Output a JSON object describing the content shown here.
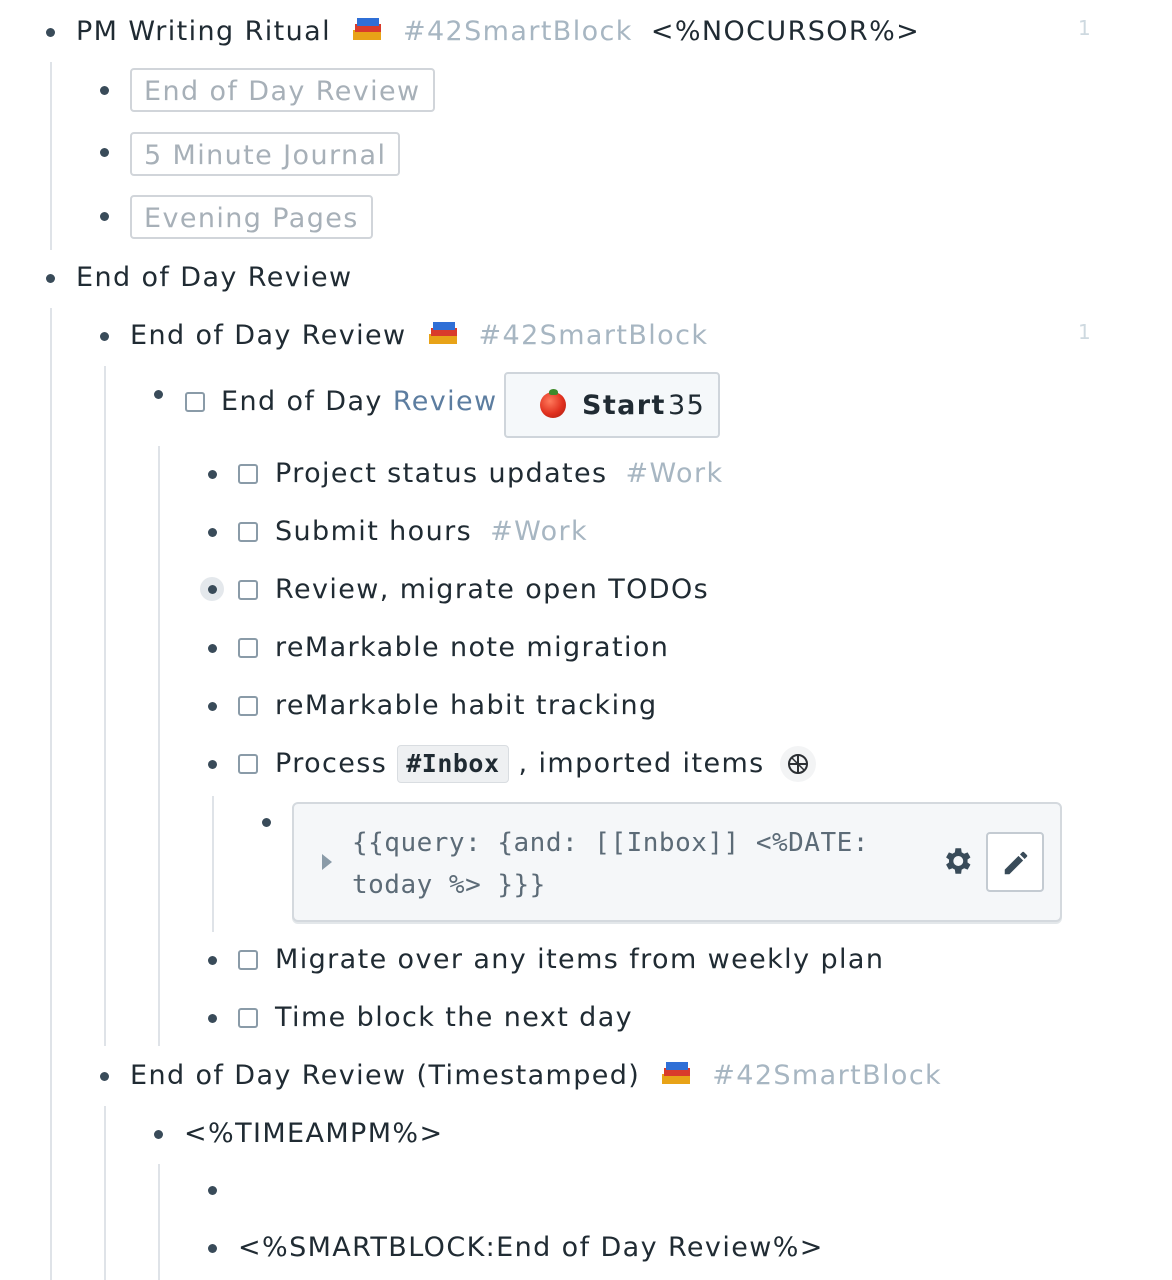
{
  "tags": {
    "smartblock": "#42SmartBlock",
    "work": "#Work",
    "inbox": "#Inbox"
  },
  "colors": {
    "tag": "#a7b6c2",
    "link": "#5c7da0",
    "text": "#202b33",
    "bullet": "#394b59"
  },
  "blocks": {
    "pm_ritual": {
      "title": "PM Writing Ritual",
      "suffix": "<%NOCURSOR%>",
      "ref_count": "1",
      "children": [
        "End of Day Review",
        "5 Minute Journal",
        "Evening Pages"
      ]
    },
    "eod": {
      "title": "End of Day Review",
      "sb_title": "End of Day Review",
      "sb_ref_count": "1",
      "task": {
        "text_plain": "End of Day ",
        "text_link": "Review",
        "button_label": "Start",
        "button_count": "35",
        "button_icon": "tomato-icon"
      },
      "items": [
        {
          "text": "Project status updates",
          "tag": "#Work"
        },
        {
          "text": "Submit hours",
          "tag": "#Work"
        },
        {
          "text": "Review, migrate open TODOs"
        },
        {
          "text": "reMarkable note migration"
        },
        {
          "text": "reMarkable habit tracking"
        },
        {
          "text_before": "Process ",
          "text_after": " , imported items"
        },
        {
          "text": "Migrate over any items from weekly plan"
        },
        {
          "text": "Time block the next day"
        }
      ],
      "query": "{{query:  {and: [[Inbox]] <%DATE: today %> }}}"
    },
    "eod_ts": {
      "title": "End of Day Review (Timestamped)",
      "time_cmd": "<%TIMEAMPM%>",
      "empty_child": "",
      "smartblock_cmd": "<%SMARTBLOCK:End of Day Review%>"
    }
  }
}
